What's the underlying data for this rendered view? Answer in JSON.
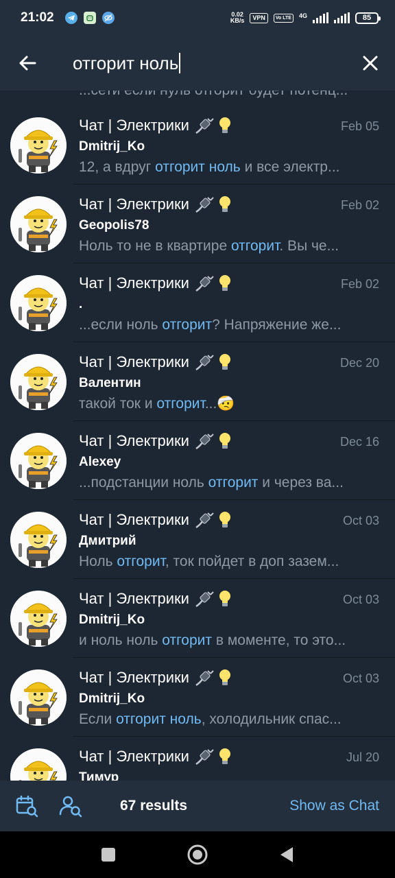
{
  "status_bar": {
    "time": "21:02",
    "net_speed_value": "0.02",
    "net_speed_unit": "KB/s",
    "vpn": "VPN",
    "volte": "Vo LTE",
    "network": "4G",
    "battery": "85",
    "app_icons": [
      "telegram-icon",
      "android-app-icon",
      "vpn-eye-icon"
    ]
  },
  "search": {
    "query": "отгорит ноль",
    "back_icon": "arrow-left-icon",
    "clear_icon": "close-icon"
  },
  "results": {
    "partial_top_snippet": "...сети если нуль отгорит будет потенц...",
    "items": [
      {
        "chat": "Чат | Электрики",
        "date": "Feb 05",
        "sender": "Dmitrij_Ko",
        "snippet": [
          {
            "t": "12, а вдруг ",
            "h": false
          },
          {
            "t": "отгорит ноль",
            "h": true
          },
          {
            "t": " и все электр...",
            "h": false
          }
        ]
      },
      {
        "chat": "Чат | Электрики",
        "date": "Feb 02",
        "sender": "Geopolis78",
        "snippet": [
          {
            "t": "Ноль то не в квартире ",
            "h": false
          },
          {
            "t": "отгорит",
            "h": true
          },
          {
            "t": ". Вы че...",
            "h": false
          }
        ]
      },
      {
        "chat": "Чат | Электрики",
        "date": "Feb 02",
        "sender": ".",
        "snippet": [
          {
            "t": "...если ноль ",
            "h": false
          },
          {
            "t": "отгорит",
            "h": true
          },
          {
            "t": "?  Напряжение же...",
            "h": false
          }
        ]
      },
      {
        "chat": "Чат | Электрики",
        "date": "Dec 20",
        "sender": "Валентин",
        "snippet": [
          {
            "t": "такой ток и ",
            "h": false
          },
          {
            "t": "отгорит",
            "h": true
          },
          {
            "t": "...🤕",
            "h": false
          }
        ]
      },
      {
        "chat": "Чат | Электрики",
        "date": "Dec 16",
        "sender": "Alexey",
        "snippet": [
          {
            "t": "...подстанции ноль ",
            "h": false
          },
          {
            "t": "отгорит",
            "h": true
          },
          {
            "t": " и через ва...",
            "h": false
          }
        ]
      },
      {
        "chat": "Чат | Электрики",
        "date": "Oct 03",
        "sender": "Дмитрий",
        "snippet": [
          {
            "t": "Ноль ",
            "h": false
          },
          {
            "t": "отгорит",
            "h": true
          },
          {
            "t": ", ток пойдет в доп зазем...",
            "h": false
          }
        ]
      },
      {
        "chat": "Чат | Электрики",
        "date": "Oct 03",
        "sender": "Dmitrij_Ko",
        "snippet": [
          {
            "t": "и ноль ноль ",
            "h": false
          },
          {
            "t": "отгорит",
            "h": true
          },
          {
            "t": " в моменте, то это...",
            "h": false
          }
        ]
      },
      {
        "chat": "Чат | Электрики",
        "date": "Oct 03",
        "sender": "Dmitrij_Ko",
        "snippet": [
          {
            "t": "Если ",
            "h": false
          },
          {
            "t": "отгорит ноль",
            "h": true
          },
          {
            "t": ", холодильник спас...",
            "h": false
          }
        ]
      },
      {
        "chat": "Чат | Электрики",
        "date": "Jul 20",
        "sender": "Тимур",
        "snippet": []
      }
    ]
  },
  "bottom_bar": {
    "calendar_icon": "calendar-search-icon",
    "user_icon": "user-search-icon",
    "results_count": "67 results",
    "show_as_chat": "Show as Chat"
  },
  "nav_bar": {
    "icons": [
      "recents-square-icon",
      "home-circle-icon",
      "back-triangle-icon"
    ]
  },
  "colors": {
    "background": "#1d2733",
    "header": "#232f3c",
    "highlight": "#71baf2",
    "secondary_text": "#8d99a6",
    "date_text": "#7d8b99"
  }
}
